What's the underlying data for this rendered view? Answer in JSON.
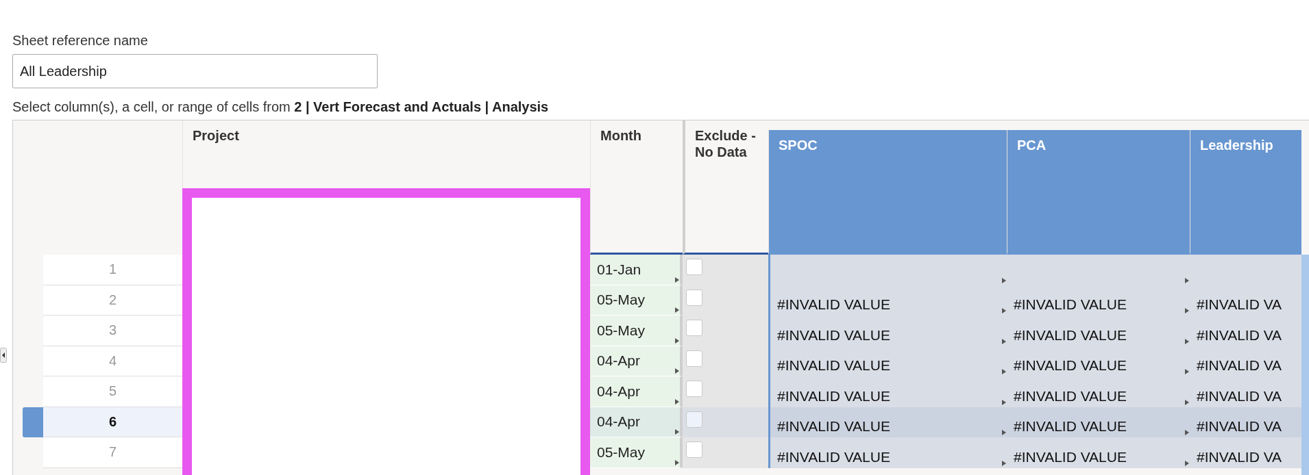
{
  "sheet_reference": {
    "label": "Sheet reference name",
    "value": "All Leadership"
  },
  "instruction": "Select column(s), a cell, or range of cells from **2 | Vert Forecast and Actuals | Analysis**",
  "grid": {
    "columns": [
      {
        "title": "Project",
        "kind": "plain"
      },
      {
        "title": "Month",
        "kind": "plain"
      },
      {
        "title": "Exclude - No Data",
        "kind": "plain"
      },
      {
        "title": "SPOC",
        "kind": "selected"
      },
      {
        "title": "PCA",
        "kind": "selected"
      },
      {
        "title": "Leadership",
        "kind": "selected"
      }
    ],
    "rows": [
      {
        "number": "1",
        "selected": false,
        "month": "01-Jan",
        "exclude": false
      },
      {
        "number": "2",
        "selected": false,
        "month": "05-May",
        "exclude": false,
        "values": [
          "#INVALID VALUE",
          "#INVALID VALUE",
          "#INVALID VA"
        ]
      },
      {
        "number": "3",
        "selected": false,
        "month": "05-May",
        "exclude": false,
        "values": [
          "#INVALID VALUE",
          "#INVALID VALUE",
          "#INVALID VA"
        ]
      },
      {
        "number": "4",
        "selected": false,
        "month": "04-Apr",
        "exclude": false,
        "values": [
          "#INVALID VALUE",
          "#INVALID VALUE",
          "#INVALID VA"
        ]
      },
      {
        "number": "5",
        "selected": false,
        "month": "04-Apr",
        "exclude": false,
        "values": [
          "#INVALID VALUE",
          "#INVALID VALUE",
          "#INVALID VA"
        ]
      },
      {
        "number": "6",
        "selected": true,
        "month": "04-Apr",
        "exclude": false,
        "values": [
          "#INVALID VALUE",
          "#INVALID VALUE",
          "#INVALID VA"
        ]
      },
      {
        "number": "7",
        "selected": false,
        "month": "05-May",
        "exclude": false,
        "values": [
          "#INVALID VALUE",
          "#INVALID VALUE",
          "#INVALID VA"
        ]
      }
    ]
  }
}
